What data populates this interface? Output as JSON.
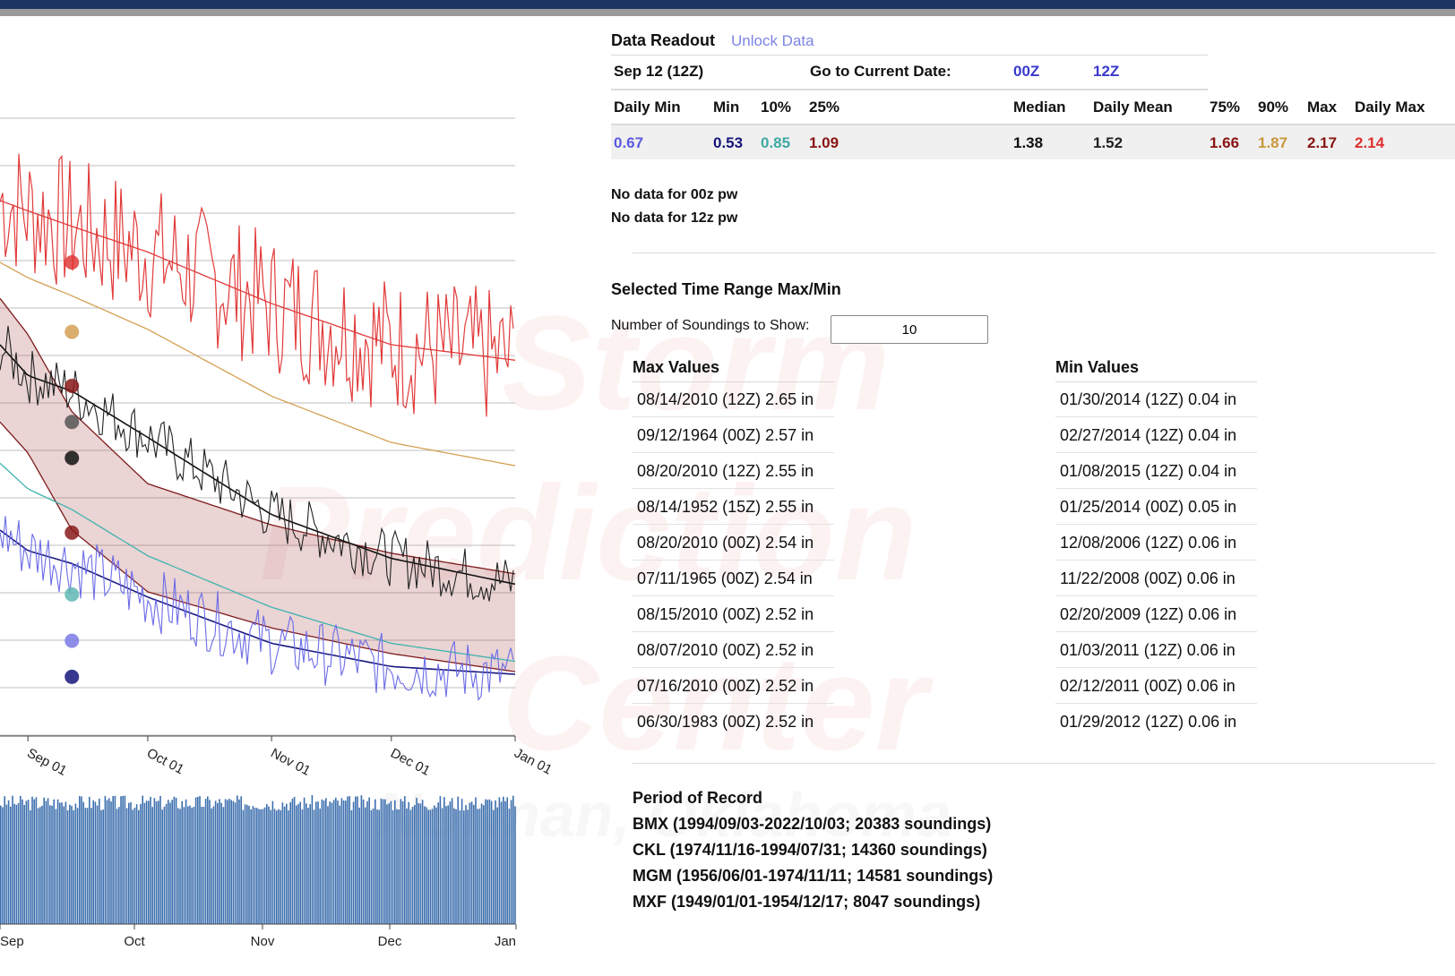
{
  "header": {
    "title": "Data Readout",
    "unlock_label": "Unlock Data"
  },
  "date_row": {
    "current": "Sep 12 (12Z)",
    "goto_label": "Go to Current Date:",
    "link_00z": "00Z",
    "link_12z": "12Z"
  },
  "stats": {
    "headers": [
      "Daily Min",
      "Min",
      "10%",
      "25%",
      "Median",
      "Daily Mean",
      "75%",
      "90%",
      "Max",
      "Daily Max"
    ],
    "values": [
      "0.67",
      "0.53",
      "0.85",
      "1.09",
      "1.38",
      "1.52",
      "1.66",
      "1.87",
      "2.17",
      "2.14"
    ],
    "colors": [
      "#5b5be0",
      "#15157a",
      "#3fa8a3",
      "#8a1313",
      "#111111",
      "#222222",
      "#8a1313",
      "#c9973a",
      "#8a1313",
      "#e03030"
    ]
  },
  "messages": [
    "No data for 00z pw",
    "No data for 12z pw"
  ],
  "time_range": {
    "title": "Selected Time Range Max/Min",
    "soundings_label": "Number of Soundings to Show:",
    "soundings_value": "10",
    "max_title": "Max Values",
    "min_title": "Min Values",
    "max_values": [
      "08/14/2010 (12Z)  2.65 in",
      "09/12/1964 (00Z)  2.57 in",
      "08/20/2010 (12Z)  2.55 in",
      "08/14/1952 (15Z)  2.55 in",
      "08/20/2010 (00Z)  2.54 in",
      "07/11/1965 (00Z)  2.54 in",
      "08/15/2010 (00Z)  2.52 in",
      "08/07/2010 (00Z)  2.52 in",
      "07/16/2010 (00Z)  2.52 in",
      "06/30/1983 (00Z)  2.52 in"
    ],
    "min_values": [
      "01/30/2014 (12Z)  0.04 in",
      "02/27/2014 (12Z)  0.04 in",
      "01/08/2015 (12Z)  0.04 in",
      "01/25/2014 (00Z)  0.05 in",
      "12/08/2006 (12Z)  0.06 in",
      "11/22/2008 (00Z)  0.06 in",
      "02/20/2009 (12Z)  0.06 in",
      "01/03/2011 (12Z)  0.06 in",
      "02/12/2011 (00Z)  0.06 in",
      "01/29/2012 (12Z)  0.06 in"
    ]
  },
  "period": {
    "title": "Period of Record",
    "lines": [
      "BMX (1994/09/03-2022/10/03; 20383 soundings)",
      "CKL (1974/11/16-1994/07/31; 14360 soundings)",
      "MGM (1956/06/01-1974/11/11; 14581 soundings)",
      "MXF (1949/01/01-1954/12/17; 8047 soundings)"
    ]
  },
  "watermark": [
    "Storm",
    "Prediction",
    "Center",
    "Norman, Oklahoma"
  ],
  "chart_data": [
    {
      "type": "line",
      "x_tick_labels": [
        "Sep 01",
        "Oct 01",
        "Nov 01",
        "Dec 01",
        "Jan 01"
      ],
      "x_range": [
        "Aug 25",
        "Jan 01"
      ],
      "y_range": [
        0.3,
        2.7
      ],
      "grid": true,
      "selected_date": "Sep 12",
      "band": {
        "lower": [
          1.52,
          1.4,
          1.1,
          0.86,
          0.72,
          0.62,
          0.55
        ],
        "upper": [
          2.0,
          1.86,
          1.56,
          1.28,
          1.12,
          1.01,
          0.93
        ]
      },
      "x": [
        "Aug 25",
        "Sep 01",
        "Sep 12",
        "Oct 01",
        "Nov 01",
        "Dec 01",
        "Jan 01"
      ],
      "series": [
        {
          "color": "#e23a3a",
          "values": [
            2.38,
            2.34,
            2.28,
            2.18,
            1.98,
            1.82,
            1.76
          ]
        },
        {
          "color": "#d4a053",
          "values": [
            2.14,
            2.08,
            2.01,
            1.88,
            1.62,
            1.44,
            1.35
          ]
        },
        {
          "color": "#111111",
          "values": [
            1.82,
            1.7,
            1.64,
            1.46,
            1.16,
            0.99,
            0.89
          ]
        },
        {
          "color": "#3fb3ae",
          "values": [
            1.36,
            1.26,
            1.18,
            1.0,
            0.8,
            0.66,
            0.59
          ]
        },
        {
          "color": "#1a1a80",
          "values": [
            1.1,
            1.02,
            0.97,
            0.84,
            0.66,
            0.57,
            0.54
          ]
        }
      ],
      "markers": [
        {
          "color": "#e23a3a",
          "y": 2.14
        },
        {
          "color": "#d4a053",
          "y": 1.87
        },
        {
          "color": "#8a1a1a",
          "y": 1.66
        },
        {
          "color": "#555555",
          "y": 1.52
        },
        {
          "color": "#111111",
          "y": 1.38
        },
        {
          "color": "#8a1a1a",
          "y": 1.09
        },
        {
          "color": "#5fb7b3",
          "y": 0.85
        },
        {
          "color": "#7a7ae6",
          "y": 0.67
        },
        {
          "color": "#15157a",
          "y": 0.53
        }
      ]
    },
    {
      "type": "bar",
      "x_tick_labels": [
        "Sep",
        "Oct",
        "Nov",
        "Dec",
        "Jan"
      ],
      "color": "#3d6fae"
    }
  ]
}
